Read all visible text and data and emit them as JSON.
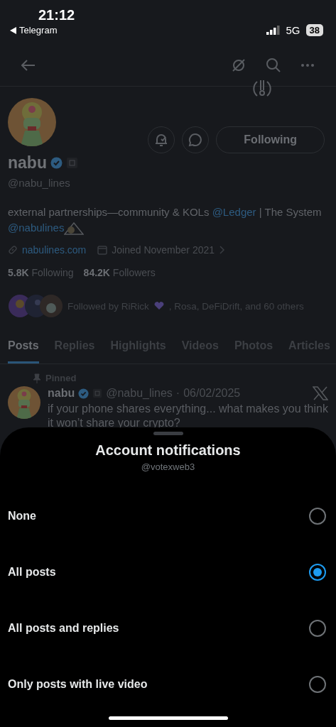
{
  "status_bar": {
    "time": "21:12",
    "back_app": "Telegram",
    "network": "5G",
    "battery": "38"
  },
  "profile": {
    "follow_button": "Following",
    "name": "nabu",
    "handle": "@nabu_lines",
    "bio": [
      {
        "kind": "text",
        "text": "external partnerships—community & KOLs "
      },
      {
        "kind": "mention",
        "text": "@Ledger"
      },
      {
        "kind": "text",
        "text": " | The System "
      },
      {
        "kind": "mention",
        "text": "@nabulines"
      }
    ],
    "website": "nabulines.com",
    "joined": "Joined November 2021",
    "following_count": "5.8K",
    "following_label": "Following",
    "followers_count": "84.2K",
    "followers_label": "Followers",
    "followed_by_start": "Followed by RiRick",
    "followed_by_end": ", Rosa, DeFiDrift, and 60 others"
  },
  "tabs": [
    {
      "label": "Posts",
      "selected": true
    },
    {
      "label": "Replies",
      "selected": false
    },
    {
      "label": "Highlights",
      "selected": false
    },
    {
      "label": "Videos",
      "selected": false
    },
    {
      "label": "Photos",
      "selected": false
    },
    {
      "label": "Articles",
      "selected": false
    }
  ],
  "pinned_post": {
    "label": "Pinned",
    "name": "nabu",
    "handle": "@nabu_lines",
    "separator": "·",
    "date": "06/02/2025",
    "text": "if your phone shares everything... what makes you think it won’t share your crypto?"
  },
  "sheet": {
    "title": "Account notifications",
    "subtitle": "@votexweb3",
    "options": [
      {
        "label": "None",
        "selected": false
      },
      {
        "label": "All posts",
        "selected": true
      },
      {
        "label": "All posts and replies",
        "selected": false
      },
      {
        "label": "Only posts with live video",
        "selected": false
      }
    ]
  }
}
